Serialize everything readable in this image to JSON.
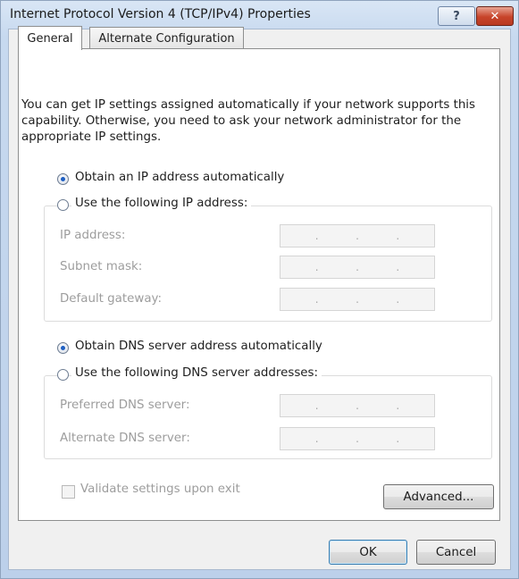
{
  "window": {
    "title": "Internet Protocol Version 4 (TCP/IPv4) Properties",
    "help_label": "?",
    "close_label": "✕"
  },
  "tabs": [
    {
      "label": "General",
      "selected": true
    },
    {
      "label": "Alternate Configuration",
      "selected": false
    }
  ],
  "description": "You can get IP settings assigned automatically if your network supports this capability. Otherwise, you need to ask your network administrator for the appropriate IP settings.",
  "ip": {
    "auto_label": "Obtain an IP address automatically",
    "auto_selected": true,
    "manual_label": "Use the following IP address:",
    "fields": [
      {
        "label": "IP address:",
        "value": ". . ."
      },
      {
        "label": "Subnet mask:",
        "value": ". . ."
      },
      {
        "label": "Default gateway:",
        "value": ". . ."
      }
    ]
  },
  "dns": {
    "auto_label": "Obtain DNS server address automatically",
    "auto_selected": true,
    "manual_label": "Use the following DNS server addresses:",
    "fields": [
      {
        "label": "Preferred DNS server:",
        "value": ". . ."
      },
      {
        "label": "Alternate DNS server:",
        "value": ". . ."
      }
    ]
  },
  "validate_label": "Validate settings upon exit",
  "advanced_label": "Advanced...",
  "ok_label": "OK",
  "cancel_label": "Cancel"
}
